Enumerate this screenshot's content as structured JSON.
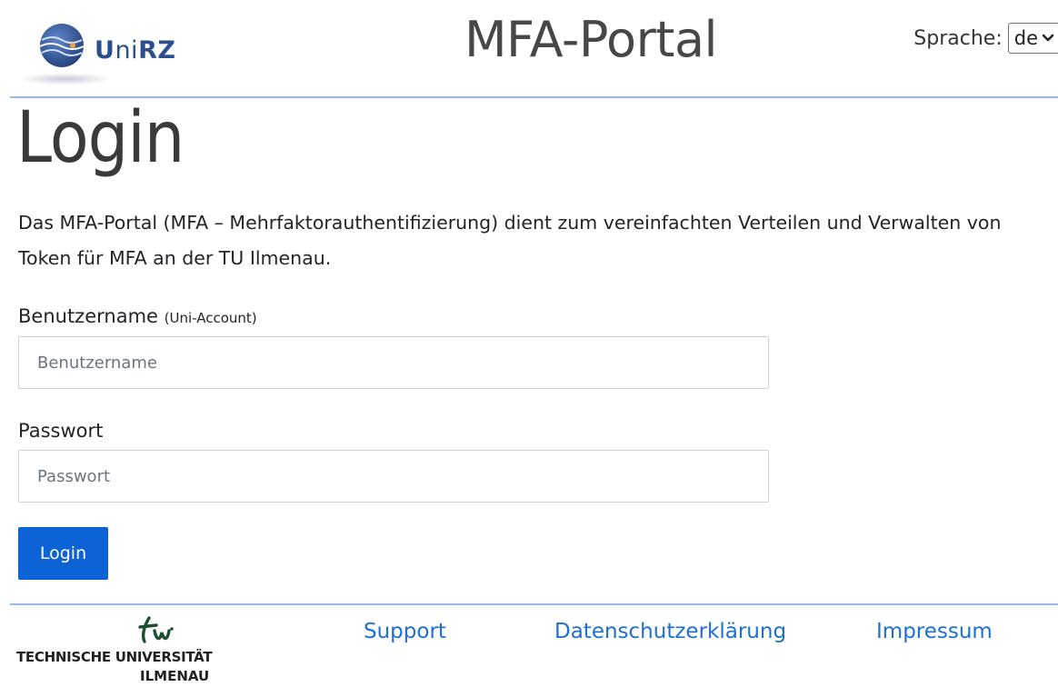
{
  "header": {
    "logo_text_u": "U",
    "logo_text_ni": "ni",
    "logo_text_rz": "RZ",
    "app_title": "MFA-Portal",
    "language_label": "Sprache:",
    "language_selected": "de"
  },
  "main": {
    "title": "Login",
    "intro": "Das MFA-Portal (MFA – Mehrfaktorauthentifizierung) dient zum vereinfachten Verteilen und Verwalten von Token für MFA an der TU Ilmenau.",
    "username_label": "Benutzername",
    "username_hint": "(Uni-Account)",
    "username_placeholder": "Benutzername",
    "username_value": "",
    "password_label": "Passwort",
    "password_placeholder": "Passwort",
    "password_value": "",
    "login_button": "Login"
  },
  "footer": {
    "university_line1": "TECHNISCHE UNIVERSITÄT",
    "university_line2": "ILMENAU",
    "links": [
      {
        "label": "Support"
      },
      {
        "label": "Datenschutzerklärung"
      },
      {
        "label": "Impressum"
      }
    ]
  },
  "colors": {
    "primary": "#0d63d6",
    "link": "#1f6fd1",
    "divider": "#9ab9e8",
    "logo_blue": "#2b4f8c"
  },
  "icons": {
    "logo": "unirz-globe-icon",
    "select_arrow": "chevron-down-icon",
    "university": "tu-ilmenau-logo"
  }
}
